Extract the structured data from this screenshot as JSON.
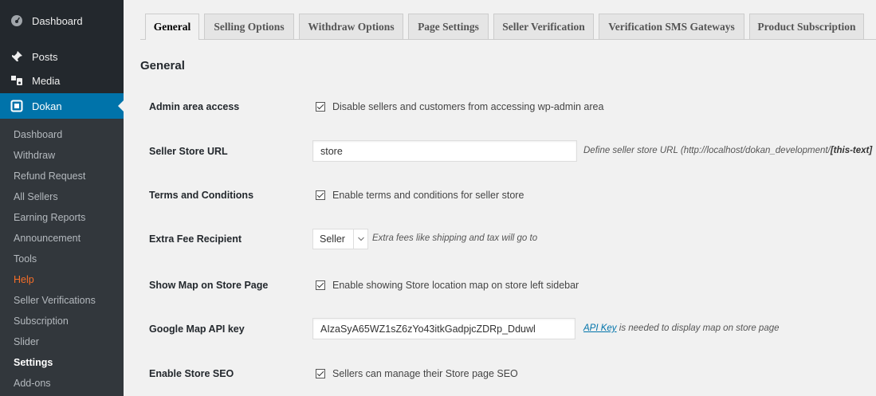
{
  "sidebar": {
    "top_items": [
      {
        "label": "Dashboard",
        "icon": "dashboard-icon"
      },
      {
        "label": "Posts",
        "icon": "pin-icon"
      },
      {
        "label": "Media",
        "icon": "media-icon"
      },
      {
        "label": "Dokan",
        "icon": "dokan-icon"
      }
    ],
    "sub_items": [
      "Dashboard",
      "Withdraw",
      "Refund Request",
      "All Sellers",
      "Earning Reports",
      "Announcement",
      "Tools",
      "Help",
      "Seller Verifications",
      "Subscription",
      "Slider",
      "Settings",
      "Add-ons"
    ]
  },
  "tabs": [
    "General",
    "Selling Options",
    "Withdraw Options",
    "Page Settings",
    "Seller Verification",
    "Verification SMS Gateways",
    "Product Subscription"
  ],
  "section_title": "General",
  "form": {
    "admin_access": {
      "label": "Admin area access",
      "text": "Disable sellers and customers from accessing wp-admin area"
    },
    "store_url": {
      "label": "Seller Store URL",
      "value": "store",
      "desc_prefix": "Define seller store URL (http://localhost/dokan_development/",
      "desc_code": "[this-text]"
    },
    "terms": {
      "label": "Terms and Conditions",
      "text": "Enable terms and conditions for seller store"
    },
    "extra_fee": {
      "label": "Extra Fee Recipient",
      "selected": "Seller",
      "desc": "Extra fees like shipping and tax will go to"
    },
    "show_map": {
      "label": "Show Map on Store Page",
      "text": "Enable showing Store location map on store left sidebar"
    },
    "map_api": {
      "label": "Google Map API key",
      "value": "AIzaSyA65WZ1sZ6zYo43itkGadpjcZDRp_Dduwl",
      "link": "API Key",
      "desc": " is needed to display map on store page"
    },
    "store_seo": {
      "label": "Enable Store SEO",
      "text": "Sellers can manage their Store page SEO"
    }
  },
  "colors": {
    "sidebar_bg": "#23282d",
    "submenu_bg": "#32373c",
    "active_blue": "#0073aa",
    "help_orange": "#f56e28"
  }
}
